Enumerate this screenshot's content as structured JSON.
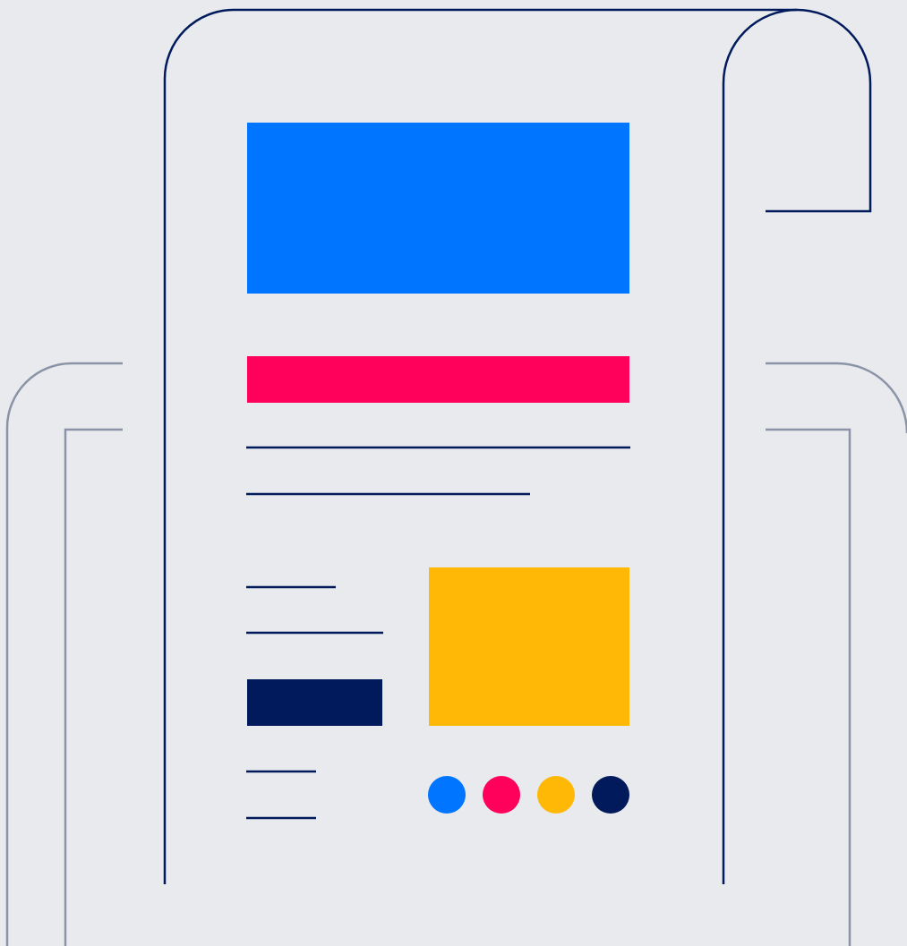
{
  "colors": {
    "background": "#E9EAEE",
    "navy": "#001A5C",
    "gray_outline": "#8A94A6",
    "blue": "#0075FF",
    "pink": "#FF005A",
    "yellow": "#FFB806"
  },
  "illustration": {
    "subject": "document-scroll",
    "icons": [
      "scroll-outline-icon",
      "folder-outline-icon"
    ],
    "color_swatches": [
      "#0075FF",
      "#FF005A",
      "#FFB806",
      "#001A5C"
    ]
  }
}
